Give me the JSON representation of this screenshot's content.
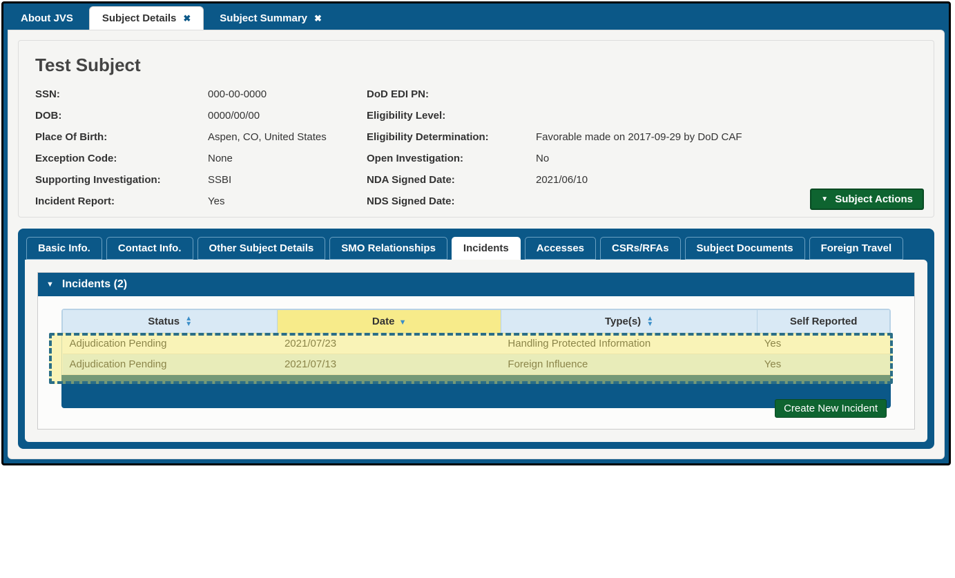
{
  "topTabs": {
    "about": "About JVS",
    "details": "Subject Details",
    "summary": "Subject Summary"
  },
  "subject": {
    "title": "Test Subject",
    "left": {
      "ssn_label": "SSN:",
      "ssn": "000-00-0000",
      "dob_label": "DOB:",
      "dob": "0000/00/00",
      "pob_label": "Place Of Birth:",
      "pob": "Aspen, CO, United States",
      "exc_label": "Exception Code:",
      "exc": "None",
      "supinv_label": "Supporting Investigation:",
      "supinv": "SSBI",
      "increp_label": "Incident Report:",
      "increp": "Yes"
    },
    "right": {
      "edi_label": "DoD EDI PN:",
      "edi": "",
      "elig_label": "Eligibility Level:",
      "elig": "",
      "eligdet_label": "Eligibility Determination:",
      "eligdet": "Favorable made on 2017-09-29 by DoD CAF",
      "openinv_label": "Open Investigation:",
      "openinv": "No",
      "nda_label": "NDA Signed Date:",
      "nda": "2021/06/10",
      "nds_label": "NDS Signed Date:",
      "nds": ""
    },
    "actions_label": "Subject Actions"
  },
  "subTabs": {
    "basic": "Basic Info.",
    "contact": "Contact Info.",
    "other": "Other Subject Details",
    "smo": "SMO Relationships",
    "incidents": "Incidents",
    "accesses": "Accesses",
    "csrs": "CSRs/RFAs",
    "docs": "Subject Documents",
    "foreign": "Foreign Travel"
  },
  "incidents": {
    "panel_title": "Incidents (2)",
    "cols": {
      "status": "Status",
      "date": "Date",
      "types": "Type(s)",
      "selfrep": "Self Reported"
    },
    "rows": [
      {
        "status": "Adjudication Pending",
        "date": "2021/07/23",
        "types": "Handling Protected Information",
        "selfrep": "Yes"
      },
      {
        "status": "Adjudication Pending",
        "date": "2021/07/13",
        "types": "Foreign Influence",
        "selfrep": "Yes"
      }
    ],
    "create_label": "Create New Incident"
  }
}
